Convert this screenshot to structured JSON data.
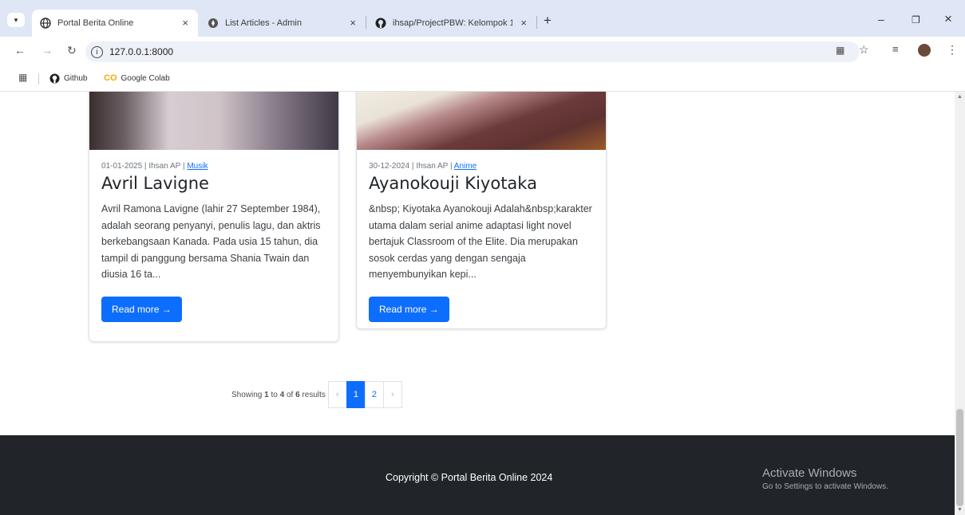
{
  "browser": {
    "tabs": [
      {
        "label": "Portal Berita Online",
        "close": "×",
        "icon": "globe-icon"
      },
      {
        "label": "List Articles - Admin",
        "close": "×",
        "icon": "compass-icon"
      },
      {
        "label": "ihsap/ProjectPBW: Kelompok 1",
        "close": "×",
        "icon": "github-icon"
      }
    ],
    "new_tab": "+",
    "window_controls": {
      "minimize": "–",
      "restore": "❐",
      "close": "×"
    },
    "url": "127.0.0.1:8000",
    "bookmarks": [
      {
        "label": "Github",
        "icon": "github-icon"
      },
      {
        "label": "Google Colab",
        "icon": "colab-icon"
      }
    ]
  },
  "articles": [
    {
      "date": "01-01-2025",
      "author": "Ihsan AP",
      "category": "Musik",
      "title": "Avril Lavigne",
      "excerpt": "Avril Ramona Lavigne (lahir 27 September 1984), adalah seorang penyanyi, penulis lagu, dan aktris berkebangsaan Kanada. Pada usia 15 tahun, dia tampil di panggung bersama Shania Twain dan diusia 16 ta...",
      "button": "Read more →"
    },
    {
      "date": "30-12-2024",
      "author": "Ihsan AP",
      "category": "Anime",
      "title": "Ayanokouji Kiyotaka",
      "excerpt": "&nbsp; Kiyotaka Ayanokouji Adalah&nbsp;karakter utama dalam serial anime adaptasi light novel bertajuk Classroom of the Elite. Dia merupakan sosok cerdas yang dengan sengaja menyembunyikan kepi...",
      "button": "Read more →"
    }
  ],
  "pagination": {
    "summary_prefix": "Showing",
    "from": "1",
    "to_word": "to",
    "to": "4",
    "of_word": "of",
    "total": "6",
    "results_word": "results",
    "prev": "‹",
    "pages": [
      "1",
      "2"
    ],
    "next": "›",
    "current_page": 1
  },
  "footer": {
    "copyright": "Copyright © Portal Berita Online 2024"
  },
  "watermark": {
    "title": "Activate Windows",
    "subtitle": "Go to Settings to activate Windows."
  },
  "colors": {
    "accent": "#0d6efd",
    "footer_bg": "#212529",
    "tabbar_bg": "#dfe6f5"
  }
}
